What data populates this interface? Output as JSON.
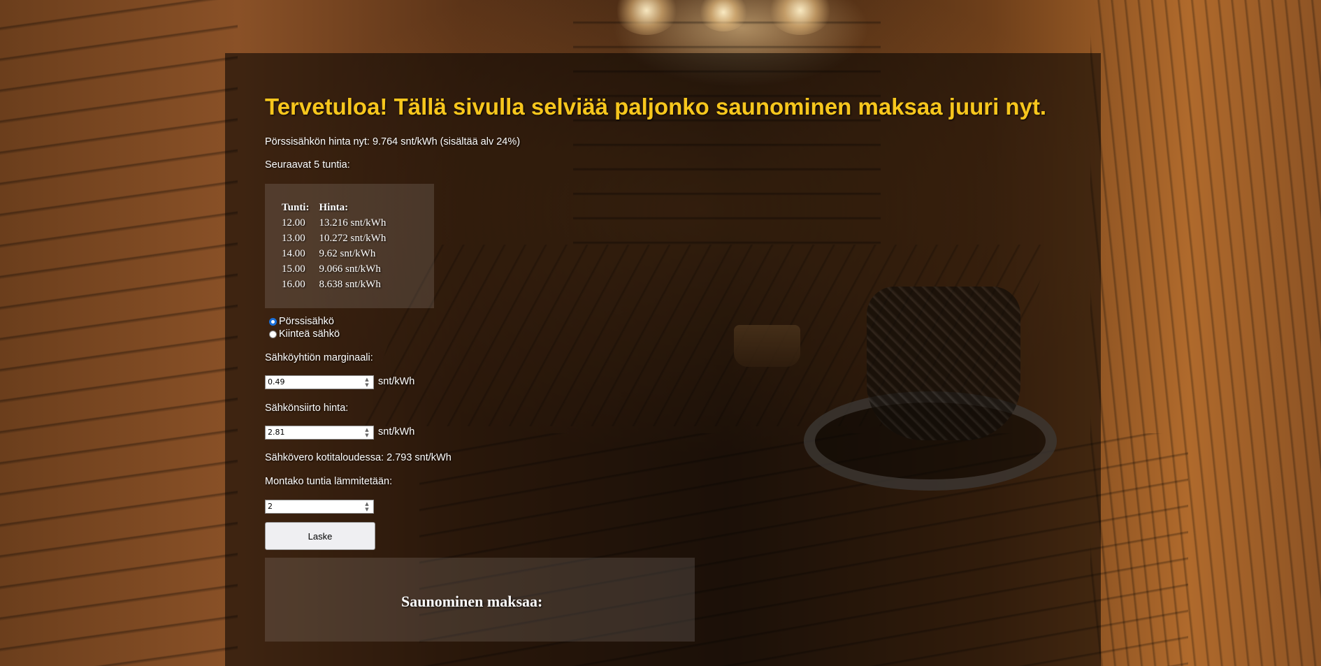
{
  "header": {
    "title": "Tervetuloa! Tällä sivulla selviää paljonko saunominen maksaa juuri nyt."
  },
  "spot_price_line": "Pörssisähkön hinta nyt: 9.764 snt/kWh (sisältää alv 24%)",
  "next_hours": {
    "label": "Seuraavat 5 tuntia:",
    "columns": [
      "Tunti:",
      "Hinta:"
    ],
    "rows": [
      {
        "hour": "12.00",
        "price": "13.216 snt/kWh"
      },
      {
        "hour": "13.00",
        "price": "10.272 snt/kWh"
      },
      {
        "hour": "14.00",
        "price": "9.62 snt/kWh"
      },
      {
        "hour": "15.00",
        "price": "9.066 snt/kWh"
      },
      {
        "hour": "16.00",
        "price": "8.638 snt/kWh"
      }
    ]
  },
  "electricity_type": {
    "options": [
      {
        "label": "Pörssisähkö",
        "selected": true
      },
      {
        "label": "Kiinteä sähkö",
        "selected": false
      }
    ]
  },
  "margin": {
    "label": "Sähköyhtiön marginaali:",
    "value": "0.49",
    "unit": "snt/kWh"
  },
  "transfer": {
    "label": "Sähkönsiirto hinta:",
    "value": "2.81",
    "unit": "snt/kWh"
  },
  "tax_line": "Sähkövero kotitaloudessa: 2.793 snt/kWh",
  "hours": {
    "label": "Montako tuntia lämmitetään:",
    "value": "2"
  },
  "calculate_button": "Laske",
  "result": {
    "title": "Saunominen maksaa:"
  },
  "colors": {
    "title": "#f7c61d",
    "radio_accent": "#1a6fd8"
  }
}
